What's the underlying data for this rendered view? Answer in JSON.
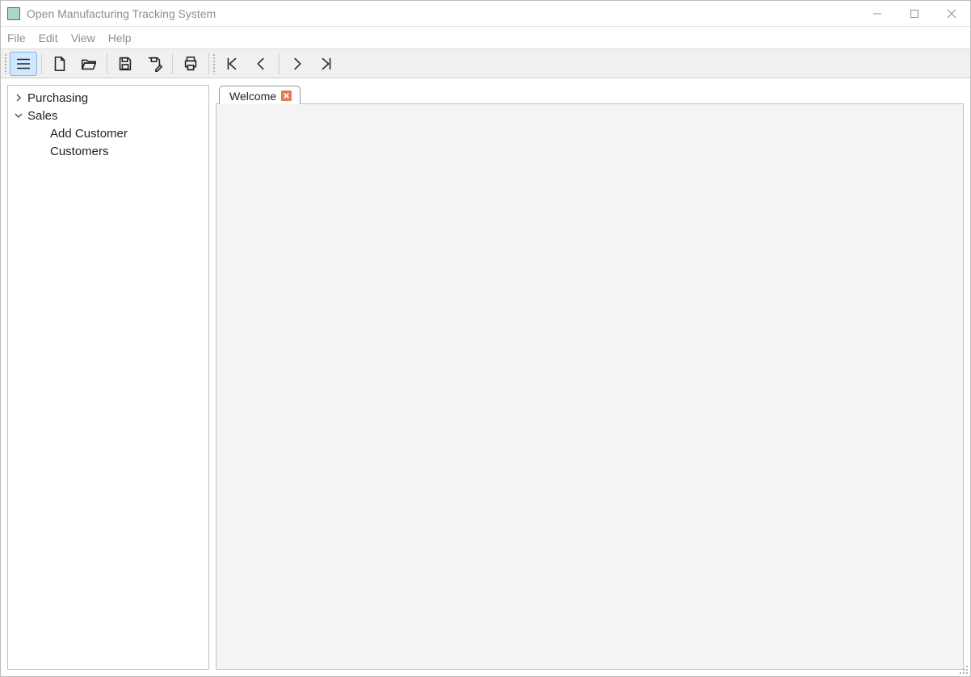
{
  "window": {
    "title": "Open Manufacturing Tracking System"
  },
  "menu": {
    "file": "File",
    "edit": "Edit",
    "view": "View",
    "help": "Help"
  },
  "sidebar": {
    "items": [
      {
        "label": "Purchasing",
        "expanded": false,
        "children": []
      },
      {
        "label": "Sales",
        "expanded": true,
        "children": [
          {
            "label": "Add Customer"
          },
          {
            "label": "Customers"
          }
        ]
      }
    ]
  },
  "tabs": [
    {
      "label": "Welcome"
    }
  ],
  "toolbar": {
    "toggle_nav": "toggle-navigation",
    "new": "new-document",
    "open": "open-folder",
    "save": "save",
    "save_as": "save-with-edit",
    "print": "print",
    "first": "go-first",
    "prev": "go-previous",
    "next": "go-next",
    "last": "go-last"
  }
}
